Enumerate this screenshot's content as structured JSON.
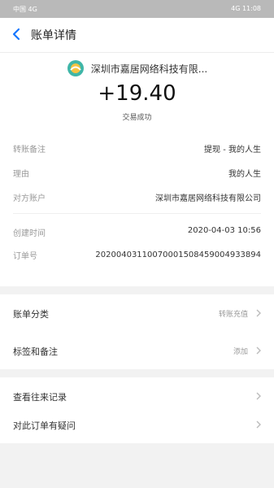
{
  "status_bar": {
    "left": "中国 4G",
    "right": "4G 11:08"
  },
  "header": {
    "title": "账单详情"
  },
  "merchant": {
    "name": "深圳市嘉居网络科技有限..."
  },
  "transaction": {
    "amount": "+19.40",
    "status": "交易成功"
  },
  "details": [
    {
      "label": "转账备注",
      "value": "提现 - 我的人生"
    },
    {
      "label": "理由",
      "value": "我的人生"
    },
    {
      "label": "对方账户",
      "value": "深圳市嘉居网络科技有限公司"
    }
  ],
  "details2": [
    {
      "label": "创建时间",
      "value": "2020-04-03 10:56"
    },
    {
      "label": "订单号",
      "value": "20200403110070001508459004933894"
    }
  ],
  "menu1": [
    {
      "label": "账单分类",
      "hint": "转账充值"
    },
    {
      "label": "标签和备注",
      "hint": "添加"
    }
  ],
  "menu2": [
    {
      "label": "查看往来记录",
      "hint": ""
    },
    {
      "label": "对此订单有疑问",
      "hint": ""
    }
  ],
  "colors": {
    "accent": "#1677ff",
    "status_bar": "#b9b9b9",
    "section_bg": "#f2f2f2"
  }
}
